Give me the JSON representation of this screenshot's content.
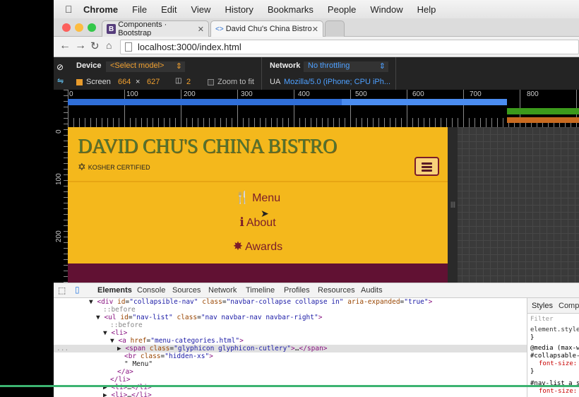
{
  "menubar": {
    "apple": "",
    "items": [
      "Chrome",
      "File",
      "Edit",
      "View",
      "History",
      "Bookmarks",
      "People",
      "Window",
      "Help"
    ]
  },
  "tabs": [
    {
      "label": "Components · Bootstrap",
      "favicon": "B"
    },
    {
      "label": "David Chu's China Bistro",
      "favicon": "<>"
    }
  ],
  "address": {
    "url": "localhost:3000/index.html"
  },
  "device": {
    "device_label": "Device",
    "model": "<Select model>",
    "screen_label": "Screen",
    "width": "664",
    "times": "×",
    "height": "627",
    "dpr": "2",
    "zoom_label": "Zoom to fit",
    "network_label": "Network",
    "throttle": "No throttling",
    "ua_label": "UA",
    "ua": "Mozilla/5.0 (iPhone; CPU iPh..."
  },
  "ruler": {
    "h": [
      "0",
      "100",
      "200",
      "300",
      "400",
      "500",
      "600",
      "700",
      "800"
    ],
    "v": [
      "0",
      "100",
      "200"
    ]
  },
  "site": {
    "brand": "DAVID CHU'S CHINA BISTRO",
    "kosher": "KOSHER CERTIFIED",
    "nav": [
      {
        "label": "Menu",
        "icon": "cutlery-icon",
        "glyph": "🍴"
      },
      {
        "label": "About",
        "icon": "info-icon",
        "glyph": "ℹ"
      },
      {
        "label": "Awards",
        "icon": "award-icon",
        "glyph": "✸"
      }
    ]
  },
  "devtools": {
    "tabs": [
      "Elements",
      "Console",
      "Sources",
      "Network",
      "Timeline",
      "Profiles",
      "Resources",
      "Audits"
    ],
    "styles_tabs": [
      "Styles",
      "Compu"
    ],
    "styles_lines": [
      "Filter",
      "element.style",
      "}",
      "@media (max-w",
      "#collapsable-",
      "font-size:",
      "}",
      "#nav-list a s",
      "font-size:"
    ]
  },
  "colors": {
    "site_bg": "#f4b81c",
    "brand_green": "#4f7532",
    "maroon": "#7b1c2a",
    "footer": "#611133"
  }
}
